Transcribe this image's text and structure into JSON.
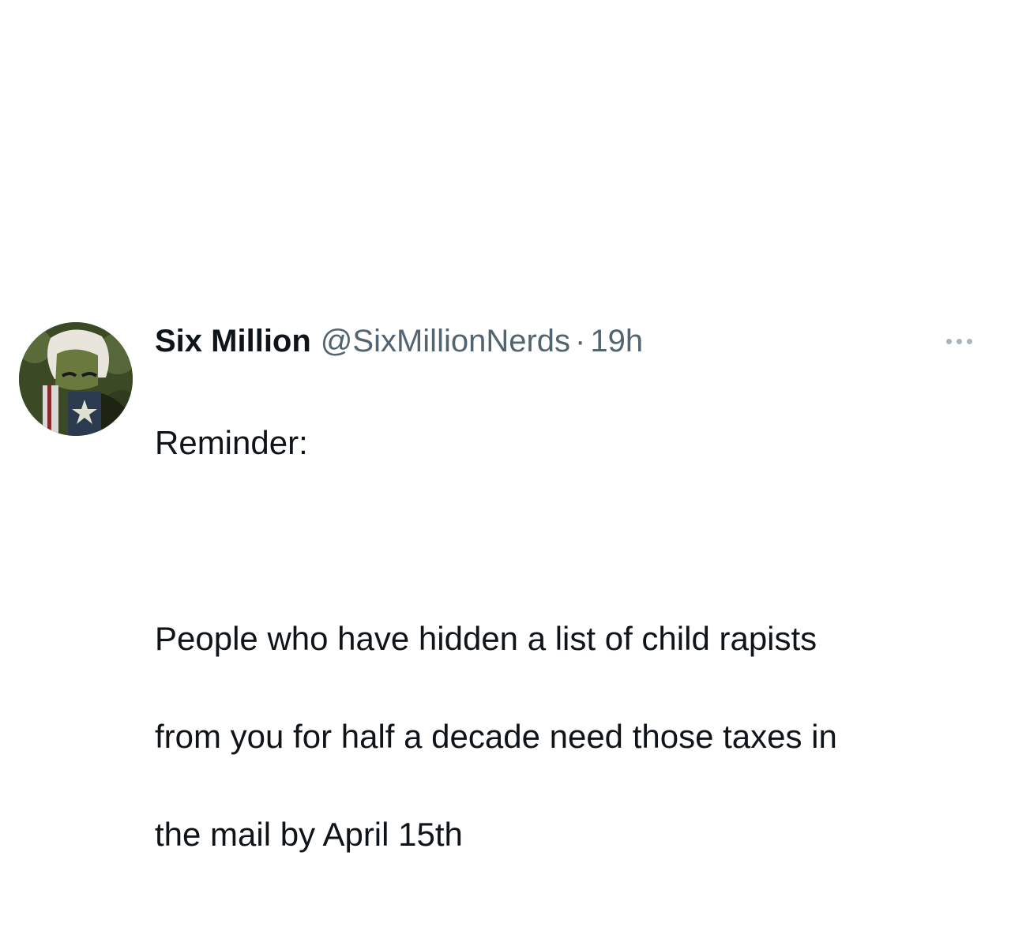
{
  "tweet": {
    "author": {
      "display_name": "Six Million",
      "handle": "@SixMillionNerds",
      "avatar_icon": "profile-avatar"
    },
    "separator": "·",
    "timestamp": "19h",
    "more_icon": "more-options-icon",
    "text_lines": [
      "Reminder:",
      "People who have hidden a list of child rapists",
      "from you for half a decade need those taxes in",
      "the mail by April 15th"
    ]
  },
  "colors": {
    "primary_text": "#0f1419",
    "secondary_text": "#536471",
    "background": "#ffffff"
  }
}
